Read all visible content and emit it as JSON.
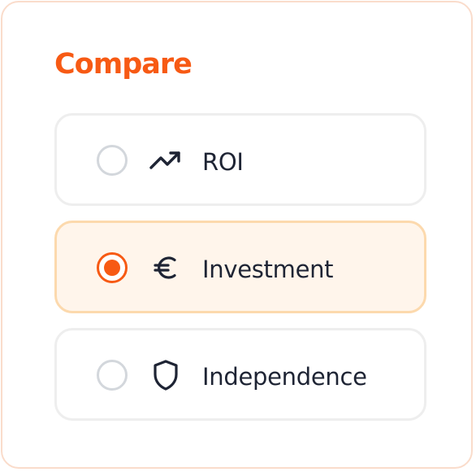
{
  "card": {
    "title": "Compare",
    "accent_color": "#f75a14"
  },
  "options": [
    {
      "label": "ROI",
      "icon": "trending-up-icon",
      "selected": false
    },
    {
      "label": "Investment",
      "icon": "euro-icon",
      "selected": true
    },
    {
      "label": "Independence",
      "icon": "shield-icon",
      "selected": false
    }
  ],
  "colors": {
    "selected_background": "#fff5eb",
    "selected_border": "#fcd9ad",
    "text": "#1e2434",
    "radio_unselected": "#d3d7dc"
  }
}
